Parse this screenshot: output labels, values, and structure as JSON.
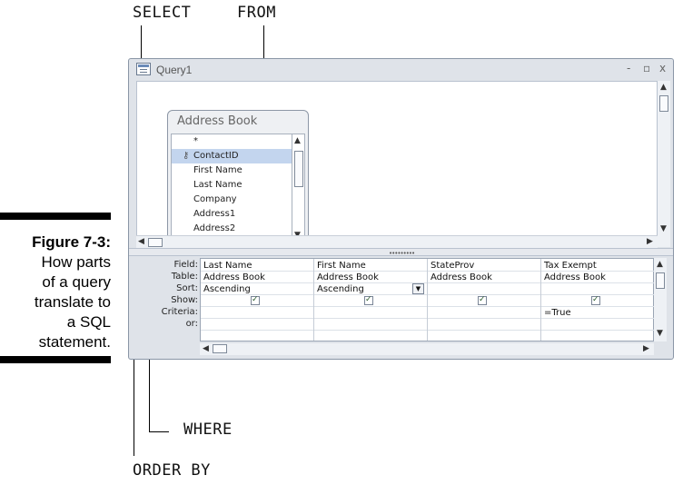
{
  "labels": {
    "select": "SELECT",
    "from": "FROM",
    "where": "WHERE",
    "order_by": "ORDER BY"
  },
  "caption": {
    "figure": "Figure 7-3:",
    "lines": [
      "How parts",
      "of a query",
      "translate to",
      "a SQL",
      "statement."
    ]
  },
  "window": {
    "title": "Query1",
    "minimize": "-",
    "restore": "▫",
    "close": "x"
  },
  "table": {
    "title": "Address Book",
    "fields": [
      "*",
      "ContactID",
      "First Name",
      "Last Name",
      "Company",
      "Address1",
      "Address2"
    ],
    "selected_index": 1
  },
  "grid": {
    "row_labels": [
      "Field:",
      "Table:",
      "Sort:",
      "Show:",
      "Criteria:",
      "or:"
    ],
    "columns": [
      {
        "field": "Last Name",
        "table": "Address Book",
        "sort": "Ascending",
        "show": true,
        "criteria": ""
      },
      {
        "field": "First Name",
        "table": "Address Book",
        "sort": "Ascending",
        "show": true,
        "criteria": ""
      },
      {
        "field": "StateProv",
        "table": "Address Book",
        "sort": "",
        "show": true,
        "criteria": ""
      },
      {
        "field": "Tax Exempt",
        "table": "Address Book",
        "sort": "",
        "show": true,
        "criteria": "=True"
      }
    ]
  },
  "icons": {
    "window_icon": "query-icon",
    "key": "primary-key-icon",
    "dropdown": "chevron-down-icon"
  }
}
